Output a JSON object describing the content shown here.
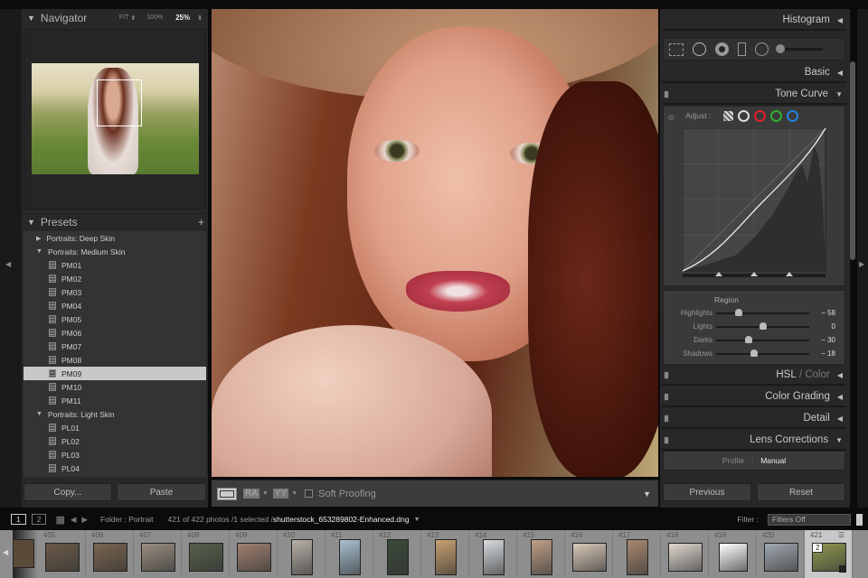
{
  "navigator": {
    "title": "Navigator",
    "zoom_fit": "FIT",
    "zoom_100": "100%",
    "zoom_25": "25%"
  },
  "presets": {
    "title": "Presets",
    "add": "+",
    "items": [
      {
        "label": "Portraits: Deep Skin",
        "type": "folder",
        "open": false
      },
      {
        "label": "Portraits: Medium Skin",
        "type": "folder",
        "open": true
      },
      {
        "label": "PM01"
      },
      {
        "label": "PM02"
      },
      {
        "label": "PM03"
      },
      {
        "label": "PM04"
      },
      {
        "label": "PM05"
      },
      {
        "label": "PM06"
      },
      {
        "label": "PM07"
      },
      {
        "label": "PM08"
      },
      {
        "label": "PM09",
        "selected": true
      },
      {
        "label": "PM10"
      },
      {
        "label": "PM11"
      },
      {
        "label": "Portraits: Light Skin",
        "type": "folder",
        "open": true
      },
      {
        "label": "PL01"
      },
      {
        "label": "PL02"
      },
      {
        "label": "PL03"
      },
      {
        "label": "PL04"
      }
    ]
  },
  "left_buttons": {
    "copy": "Copy...",
    "paste": "Paste"
  },
  "toolbar": {
    "soft_proofing": "Soft Proofing",
    "ra": "RA",
    "yy": "YY"
  },
  "right": {
    "histogram": "Histogram",
    "basic": "Basic",
    "tone_curve": "Tone Curve",
    "adjust": "Adjust :",
    "region": "Region",
    "sliders": [
      {
        "label": "Highlights",
        "value": "− 58",
        "pos": 0.24
      },
      {
        "label": "Lights",
        "value": "0",
        "pos": 0.5
      },
      {
        "label": "Darks",
        "value": "− 30",
        "pos": 0.35
      },
      {
        "label": "Shadows",
        "value": "− 18",
        "pos": 0.41
      }
    ],
    "hsl": "HSL",
    "color": "Color",
    "color_grading": "Color Grading",
    "detail": "Detail",
    "lens": "Lens Corrections",
    "profile": "Profile",
    "manual": "Manual",
    "previous": "Previous",
    "reset": "Reset"
  },
  "filmstrip_bar": {
    "screen1": "1",
    "screen2": "2",
    "source": "Folder : Portrait",
    "count": "421 of 422 photos /1 selected /",
    "filename": "shutterstock_653289802-Enhanced.dng",
    "filter_label": "Filter :",
    "filter_value": "Filters Off"
  },
  "filmstrip": [
    {
      "n": "405",
      "c": "#6b5a48"
    },
    {
      "n": "406",
      "c": "#7a6450"
    },
    {
      "n": "407",
      "c": "#9a8e80"
    },
    {
      "n": "408",
      "c": "#55604a"
    },
    {
      "n": "409",
      "c": "#a08070"
    },
    {
      "n": "410",
      "c": "#b8b0a8"
    },
    {
      "n": "411",
      "c": "#a8c0d0"
    },
    {
      "n": "412",
      "c": "#3a4a3a"
    },
    {
      "n": "413",
      "c": "#c8a070"
    },
    {
      "n": "414",
      "c": "#d8dce0"
    },
    {
      "n": "415",
      "c": "#c0a088"
    },
    {
      "n": "416",
      "c": "#d8c8b8"
    },
    {
      "n": "417",
      "c": "#a88870"
    },
    {
      "n": "418",
      "c": "#e0d8d0"
    },
    {
      "n": "419",
      "c": "#ffffff"
    },
    {
      "n": "420",
      "c": "#a0a8b0"
    },
    {
      "n": "421",
      "c": "#909850",
      "selected": true,
      "badge": "2"
    }
  ]
}
